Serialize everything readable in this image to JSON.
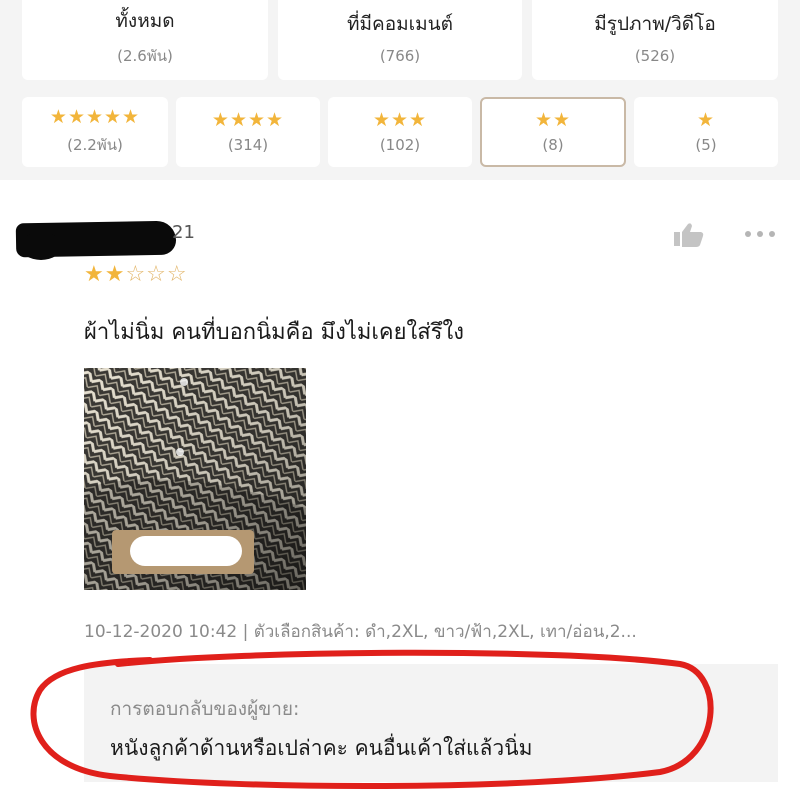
{
  "filters": {
    "tabs": [
      {
        "label": "ทั้งหมด",
        "count": "(2.6พัน)"
      },
      {
        "label": "ที่มีคอมเมนต์",
        "count": "(766)"
      },
      {
        "label": "มีรูปภาพ/วิดีโอ",
        "count": "(526)"
      }
    ],
    "star_tabs": [
      {
        "stars": "★★★★★",
        "count": "(2.2พัน)"
      },
      {
        "stars": "★★★★",
        "count": "(314)"
      },
      {
        "stars": "★★★",
        "count": "(102)"
      },
      {
        "stars": "★★",
        "count": "(8)",
        "selected": true
      },
      {
        "stars": "★",
        "count": "(5)"
      }
    ]
  },
  "review": {
    "username_visible": "21",
    "rating": 2,
    "rating_on": "★★",
    "rating_off": "☆☆☆",
    "comment": "ผ้าไม่นิ่ม คนที่บอกนิ่มคือ มึงไม่เคยใส่รึใง",
    "meta": "10-12-2020 10:42 | ตัวเลือกสินค้า: ดำ,2XL, ขาว/ฟ้า,2XL, เทา/อ่อน,2...",
    "seller_reply_label": "การตอบกลับของผู้ขาย:",
    "seller_reply": "หนังลูกค้าด้านหรือเปล่าคะ คนอื่นเค้าใส่แล้วนิ่ม"
  },
  "colors": {
    "star": "#f2b53b",
    "selected_border": "#c9b9a6",
    "annotation_red": "#e0201b"
  },
  "icons": [
    "thumbs-up-icon",
    "more-dots-icon"
  ]
}
